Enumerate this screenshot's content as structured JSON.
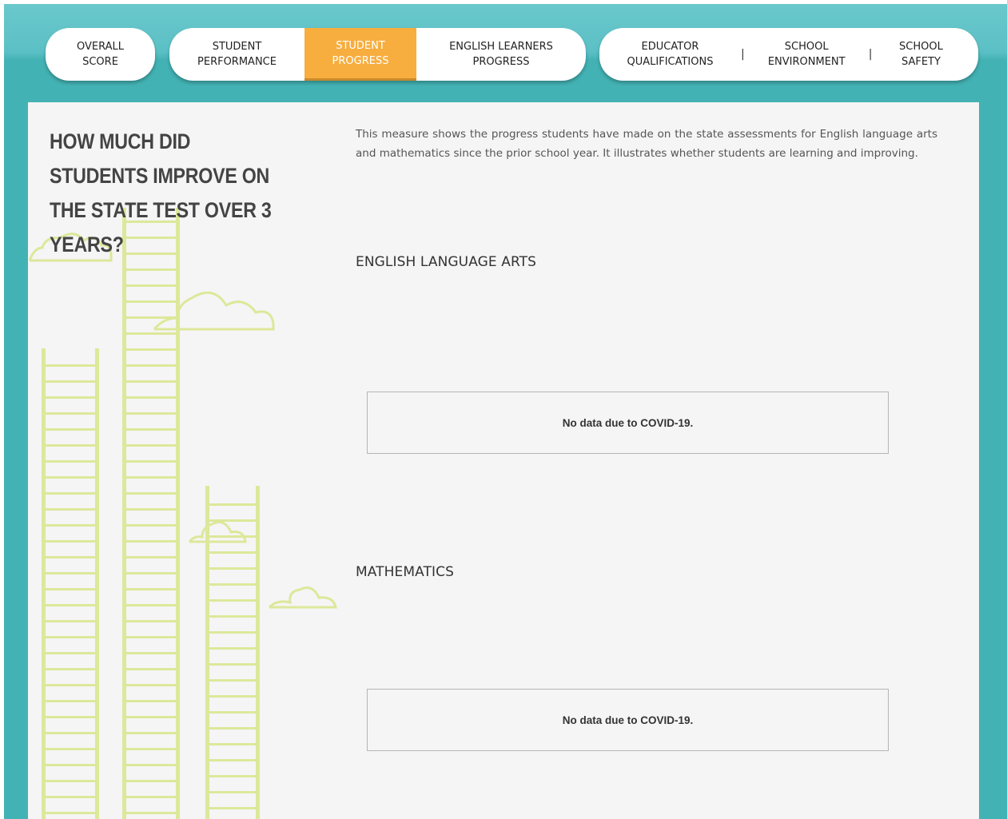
{
  "nav": {
    "overall_score": "OVERALL\nSCORE",
    "student_performance": "STUDENT\nPERFORMANCE",
    "student_progress": "STUDENT\nPROGRESS",
    "english_learners_progress": "ENGLISH LEARNERS\nPROGRESS",
    "educator_qualifications": "EDUCATOR\nQUALIFICATIONS",
    "school_environment": "SCHOOL\nENVIRONMENT",
    "school_safety": "SCHOOL\nSAFETY",
    "separator": "|",
    "active_tab": "student_progress"
  },
  "main": {
    "question": "HOW MUCH DID STUDENTS IMPROVE ON THE STATE TEST OVER 3 YEARS?",
    "intro": "This measure shows the progress students have made on the state assessments for English language arts and mathematics since the prior school year.  It illustrates whether students are learning and improving.",
    "sections": [
      {
        "title": "ENGLISH LANGUAGE ARTS",
        "message": "No data due to COVID-19."
      },
      {
        "title": "MATHEMATICS",
        "message": "No data due to COVID-19."
      }
    ]
  },
  "colors": {
    "teal_background": "#43b2b4",
    "active_tab": "#f7ae3f",
    "panel": "#f5f5f5",
    "illustration": "#dde89a"
  },
  "icons": [
    "ladder-illustration",
    "cloud-illustration"
  ]
}
